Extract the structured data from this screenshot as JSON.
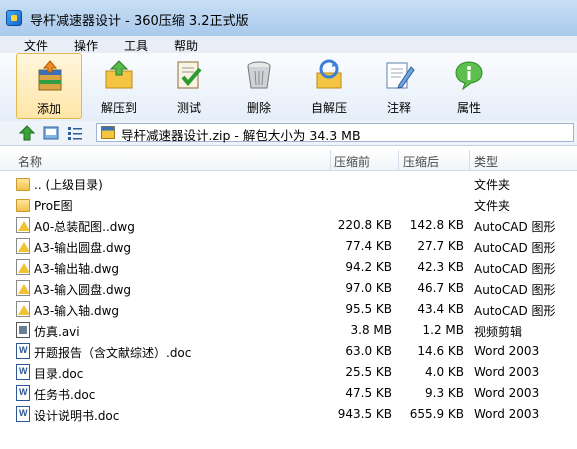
{
  "window": {
    "title": "导杆减速器设计 - 360压缩 3.2正式版"
  },
  "menu": [
    "文件",
    "操作",
    "工具",
    "帮助"
  ],
  "toolbar": [
    {
      "label": "添加",
      "icon": "add-archive-icon"
    },
    {
      "label": "解压到",
      "icon": "extract-to-icon"
    },
    {
      "label": "测试",
      "icon": "test-icon"
    },
    {
      "label": "删除",
      "icon": "trash-icon"
    },
    {
      "label": "自解压",
      "icon": "self-extract-icon"
    },
    {
      "label": "注释",
      "icon": "comment-icon"
    },
    {
      "label": "属性",
      "icon": "info-icon"
    }
  ],
  "address": {
    "path": "导杆减速器设计.zip - 解包大小为 34.3 MB"
  },
  "columns": {
    "name": "名称",
    "before": "压缩前",
    "after": "压缩后",
    "type": "类型"
  },
  "files": [
    {
      "name": ".. (上级目录)",
      "before": "",
      "after": "",
      "type": "文件夹",
      "icon": "folder"
    },
    {
      "name": "ProE图",
      "before": "",
      "after": "",
      "type": "文件夹",
      "icon": "folder"
    },
    {
      "name": "A0-总装配图..dwg",
      "before": "220.8 KB",
      "after": "142.8 KB",
      "type": "AutoCAD 图形",
      "icon": "dwg"
    },
    {
      "name": "A3-输出圆盘.dwg",
      "before": "77.4 KB",
      "after": "27.7 KB",
      "type": "AutoCAD 图形",
      "icon": "dwg"
    },
    {
      "name": "A3-输出轴.dwg",
      "before": "94.2 KB",
      "after": "42.3 KB",
      "type": "AutoCAD 图形",
      "icon": "dwg"
    },
    {
      "name": "A3-输入圆盘.dwg",
      "before": "97.0 KB",
      "after": "46.7 KB",
      "type": "AutoCAD 图形",
      "icon": "dwg"
    },
    {
      "name": "A3-输入轴.dwg",
      "before": "95.5 KB",
      "after": "43.4 KB",
      "type": "AutoCAD 图形",
      "icon": "dwg"
    },
    {
      "name": "仿真.avi",
      "before": "3.8 MB",
      "after": "1.2 MB",
      "type": "视频剪辑",
      "icon": "avi"
    },
    {
      "name": "开题报告（含文献综述）.doc",
      "before": "63.0 KB",
      "after": "14.6 KB",
      "type": "Word 2003",
      "icon": "doc"
    },
    {
      "name": "目录.doc",
      "before": "25.5 KB",
      "after": "4.0 KB",
      "type": "Word 2003",
      "icon": "doc"
    },
    {
      "name": "任务书.doc",
      "before": "47.5 KB",
      "after": "9.3 KB",
      "type": "Word 2003",
      "icon": "doc"
    },
    {
      "name": "设计说明书.doc",
      "before": "943.5 KB",
      "after": "655.9 KB",
      "type": "Word 2003",
      "icon": "doc"
    }
  ]
}
